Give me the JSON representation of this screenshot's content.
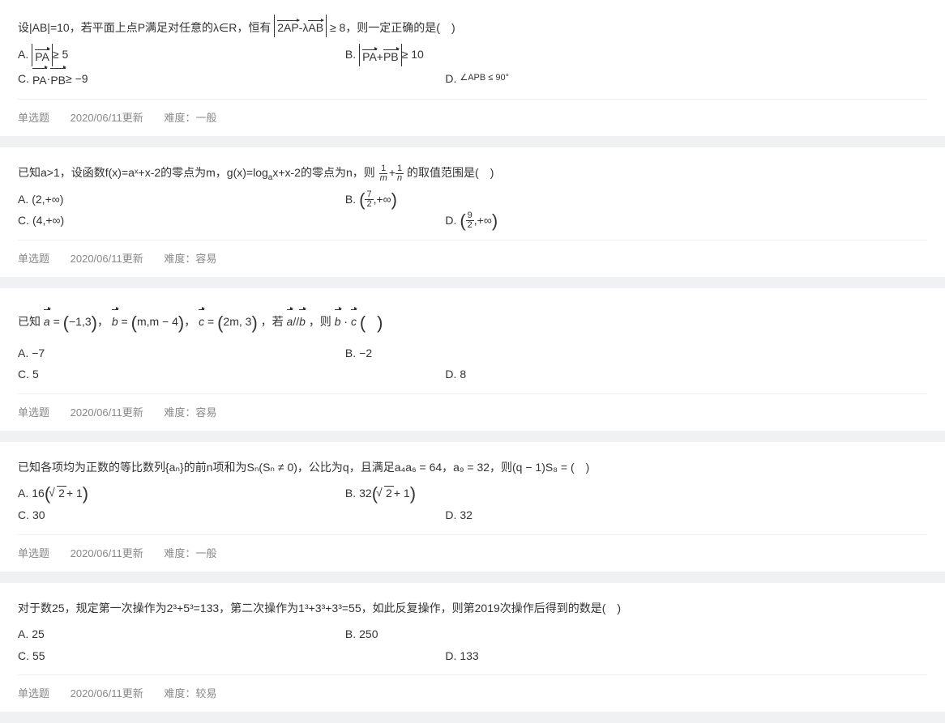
{
  "questions": [
    {
      "stem_prefix": "设|AB|=10，若平面上点P满足对任意的λ∈R，恒有",
      "stem_mid": "2AP-λAB",
      "stem_suffix": " ≥ 8，则一定正确的是( )",
      "options": {
        "A_label": "A.",
        "A_vec": "PA",
        "A_suffix": " ≥ 5",
        "B_label": "B.",
        "B_vec": "PA+PB",
        "B_suffix": " ≥ 10",
        "C_label": "C.",
        "C_vec1": "PA",
        "C_vec2": "PB",
        "C_suffix": " ≥ −9",
        "D_label": "D.",
        "D_text": "∠APB ≤ 90°"
      },
      "meta": {
        "type": "单选题",
        "updated": "2020/06/11更新",
        "difficulty": "难度：一般"
      },
      "layout": [
        36,
        36,
        47,
        20
      ]
    },
    {
      "stem_p1": "已知a>1，设函数f(x)=aˣ+x-2的零点为m，g(x)=log",
      "stem_sub": "a",
      "stem_p2": "x+x-2的零点为n，则",
      "stem_p3": "的取值范围是( )",
      "options": {
        "A_label": "A.",
        "A_text": "(2,+∞)",
        "B_label": "B.",
        "B_num": "7",
        "B_den": "2",
        "B_suffix": ",+∞",
        "C_label": "C.",
        "C_text": "(4,+∞)",
        "D_label": "D.",
        "D_num": "9",
        "D_den": "2",
        "D_suffix": ",+∞"
      },
      "meta": {
        "type": "单选题",
        "updated": "2020/06/11更新",
        "difficulty": "难度：容易"
      },
      "layout": [
        36,
        36,
        47,
        20
      ]
    },
    {
      "stem_p1": "已知",
      "avec": "a",
      "aval": "−1,3",
      "bvec": "b",
      "bval": "m,m − 4",
      "cvec": "c",
      "cval": "2m, 3",
      "stem_p2": "，若",
      "stem_p3": "，则",
      "options": {
        "A_label": "A.",
        "A_text": "−7",
        "B_label": "B.",
        "B_text": "−2",
        "C_label": "C.",
        "C_text": "5",
        "D_label": "D.",
        "D_text": "8"
      },
      "meta": {
        "type": "单选题",
        "updated": "2020/06/11更新",
        "difficulty": "难度：容易"
      },
      "layout": [
        36,
        36,
        47,
        20
      ]
    },
    {
      "stem": "已知各项均为正数的等比数列{aₙ}的前n项和为Sₙ(Sₙ ≠ 0)，公比为q，且满足a₄a₆ = 64，a₉ = 32，则(q − 1)S₈ = ( )",
      "options": {
        "A_label": "A.",
        "A_num": "16",
        "B_label": "B.",
        "B_num": "32",
        "sqrt_inner": "2",
        "sqrt_plus": " + 1",
        "C_label": "C.",
        "C_text": "30",
        "D_label": "D.",
        "D_text": "32"
      },
      "meta": {
        "type": "单选题",
        "updated": "2020/06/11更新",
        "difficulty": "难度：一般"
      },
      "layout": [
        36,
        36,
        47,
        20
      ]
    },
    {
      "stem": "对于数25，规定第一次操作为2³+5³=133，第二次操作为1³+3³+3³=55，如此反复操作，则第2019次操作后得到的数是( )",
      "options": {
        "A_label": "A.",
        "A_text": "25",
        "B_label": "B.",
        "B_text": "250",
        "C_label": "C.",
        "C_text": "55",
        "D_label": "D.",
        "D_text": "133"
      },
      "meta": {
        "type": "单选题",
        "updated": "2020/06/11更新",
        "difficulty": "难度：较易"
      },
      "layout": [
        36,
        36,
        47,
        20
      ]
    }
  ]
}
